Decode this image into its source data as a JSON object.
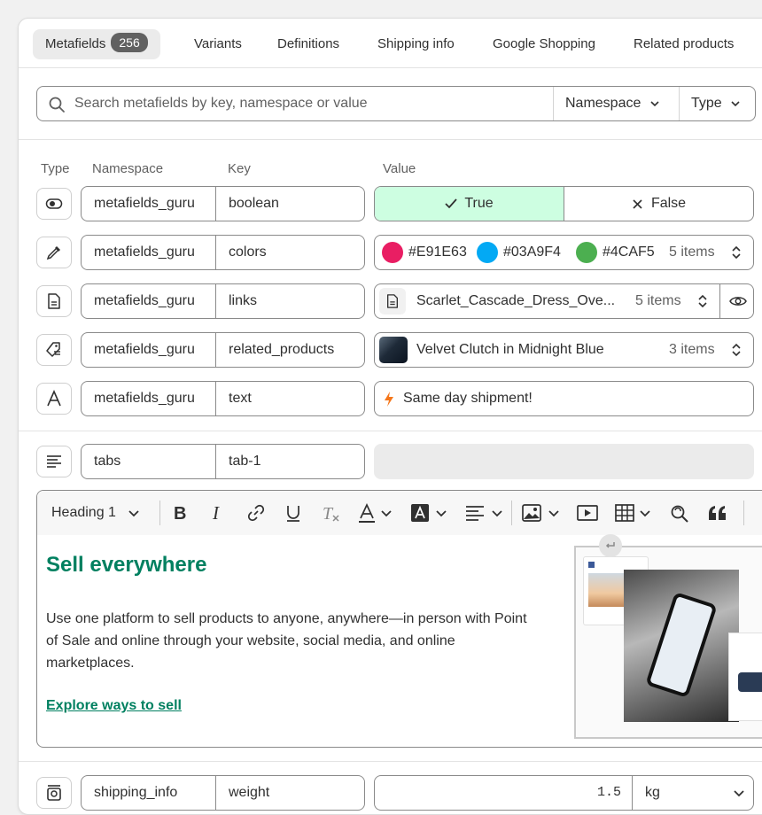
{
  "tabs": [
    {
      "label": "Metafields",
      "badge": "256"
    },
    {
      "label": "Variants"
    },
    {
      "label": "Definitions"
    },
    {
      "label": "Shipping info"
    },
    {
      "label": "Google Shopping"
    },
    {
      "label": "Related products"
    }
  ],
  "search": {
    "placeholder": "Search metafields by key, namespace or value",
    "namespace_label": "Namespace",
    "type_label": "Type"
  },
  "headers": {
    "type": "Type",
    "namespace": "Namespace",
    "key": "Key",
    "value": "Value"
  },
  "rows": [
    {
      "namespace": "metafields_guru",
      "key": "boolean",
      "type_icon": "toggle-icon",
      "true_label": "True",
      "false_label": "False",
      "selected": "True"
    },
    {
      "namespace": "metafields_guru",
      "key": "colors",
      "type_icon": "eyedropper-icon",
      "colors": [
        {
          "hex": "#E91E63",
          "label": "#E91E63"
        },
        {
          "hex": "#03A9F4",
          "label": "#03A9F4"
        },
        {
          "hex": "#4CAF50",
          "label": "#4CAF5"
        }
      ],
      "count": "5 items"
    },
    {
      "namespace": "metafields_guru",
      "key": "links",
      "type_icon": "file-icon",
      "value": "Scarlet_Cascade_Dress_Ove...",
      "count": "5 items"
    },
    {
      "namespace": "metafields_guru",
      "key": "related_products",
      "type_icon": "product-tag-icon",
      "value": "Velvet Clutch in Midnight Blue",
      "count": "3 items"
    },
    {
      "namespace": "metafields_guru",
      "key": "text",
      "type_icon": "text-icon",
      "value": "Same day shipment!"
    },
    {
      "namespace": "tabs",
      "key": "tab-1",
      "type_icon": "rich-text-icon",
      "value": ""
    },
    {
      "namespace": "shipping_info",
      "key": "weight",
      "type_icon": "weight-icon",
      "value": "1.5",
      "unit": "kg"
    }
  ],
  "editor": {
    "heading_select": "Heading 1",
    "content": {
      "title": "Sell everywhere",
      "body": "Use one platform to sell products to anyone, anywhere—in person with Point of Sale and online through your website, social media, and online marketplaces.",
      "link": "Explore ways to sell"
    }
  },
  "colors": {
    "accent_green": "#008060",
    "true_bg": "#cdfee1",
    "badge_bg": "#616161",
    "bolt": "#f5761a"
  }
}
